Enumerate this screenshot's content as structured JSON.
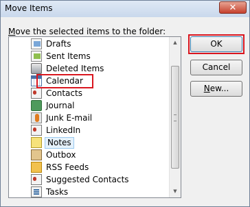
{
  "window": {
    "title": "Move Items",
    "close_glyph": "✕"
  },
  "prompt": {
    "prefix": "M",
    "rest": "ove the selected items to the folder:"
  },
  "tree": {
    "items": [
      {
        "label": "Drafts",
        "icon": "drafts-icon"
      },
      {
        "label": "Sent Items",
        "icon": "sent-items-icon"
      },
      {
        "label": "Deleted Items",
        "icon": "deleted-items-icon",
        "expander": "▷"
      },
      {
        "label": "Calendar",
        "icon": "calendar-icon"
      },
      {
        "label": "Contacts",
        "icon": "contacts-icon"
      },
      {
        "label": "Journal",
        "icon": "journal-icon"
      },
      {
        "label": "Junk E-mail",
        "icon": "junk-email-icon"
      },
      {
        "label": "LinkedIn",
        "icon": "contacts-icon"
      },
      {
        "label": "Notes",
        "icon": "notes-icon",
        "selected": true
      },
      {
        "label": "Outbox",
        "icon": "outbox-icon"
      },
      {
        "label": "RSS Feeds",
        "icon": "rss-feeds-icon",
        "expander": "▷"
      },
      {
        "label": "Suggested Contacts",
        "icon": "contacts-icon"
      },
      {
        "label": "Tasks",
        "icon": "tasks-icon"
      }
    ]
  },
  "buttons": {
    "ok": "OK",
    "cancel": "Cancel",
    "new_prefix": "N",
    "new_rest": "ew..."
  },
  "scrollbar": {
    "up_glyph": "▲",
    "down_glyph": "▼"
  },
  "colors": {
    "highlight": "#d9151e",
    "selection": "#e5f1fb"
  }
}
